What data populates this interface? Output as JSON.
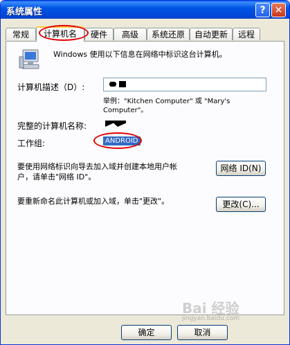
{
  "window": {
    "title": "系统属性",
    "help_label": "?",
    "close_label": "✕"
  },
  "tabs": [
    "常规",
    "计算机名",
    "硬件",
    "高级",
    "系统还原",
    "自动更新",
    "远程"
  ],
  "panel": {
    "intro": "Windows 使用以下信息在网络中标识这台计算机。",
    "description_label": "计算机描述（D）:",
    "description_hint": "举例：\"Kitchen Computer\" 或 \"Mary's\nComputer\"。",
    "full_name_label": "完整的计算机名称:",
    "workgroup_label": "工作组:",
    "workgroup_value": "ANDROID",
    "network_text": "要使用网络标识向导去加入域并创建本地用户帐\n户，请单击\"网络 ID\"。",
    "network_button": "网络 ID(N)",
    "rename_text": "要重新命名此计算机或加入域，单击\"更改\"。",
    "change_button": "更改(C)..."
  },
  "footer": {
    "ok_button": "确定",
    "cancel_button": "取消"
  },
  "watermark": {
    "brand": "Bai 经验",
    "url": "jingyan.baidu.com"
  },
  "colors": {
    "accent": "#0055E5",
    "highlight": "#316AC5",
    "annotation": "#E00000"
  }
}
